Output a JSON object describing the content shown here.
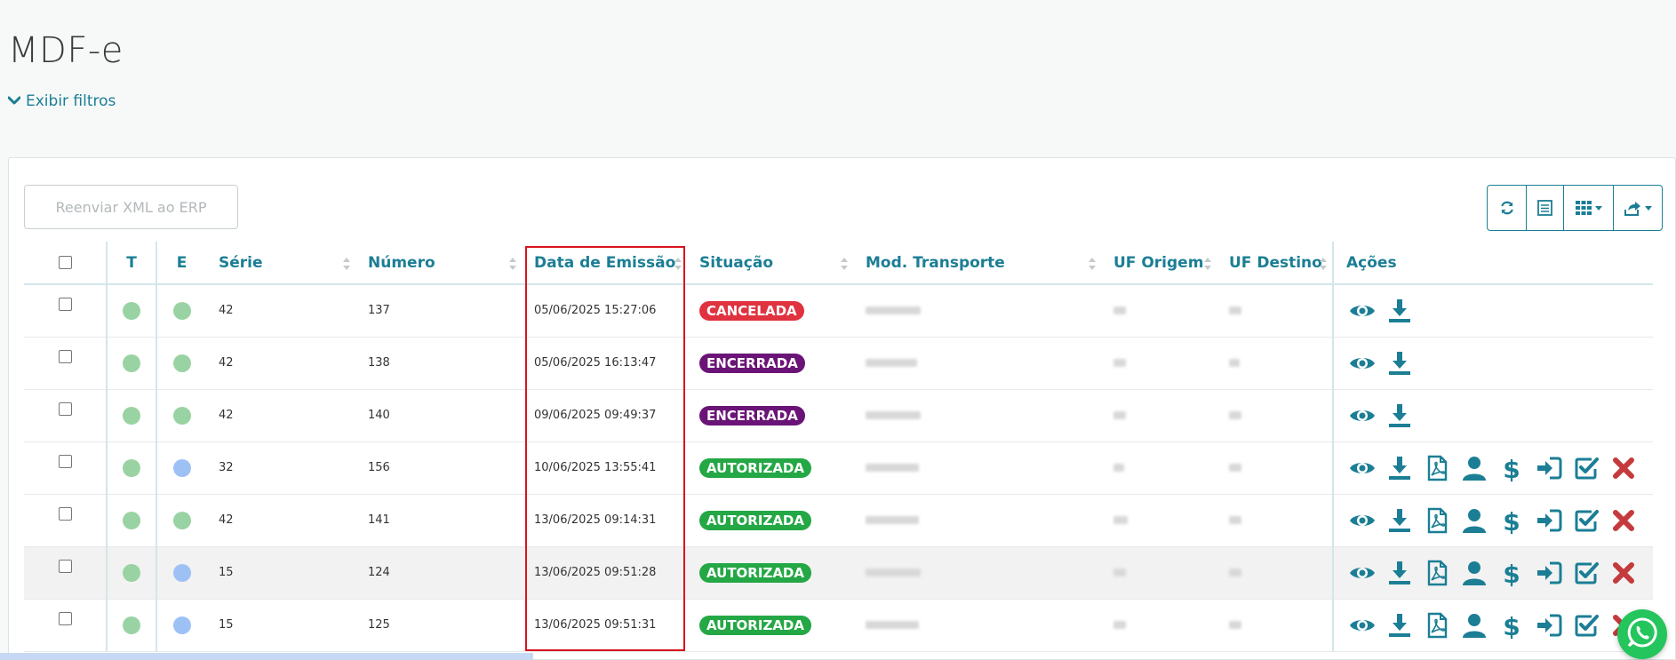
{
  "page": {
    "title": "MDF-e"
  },
  "filters": {
    "label": "Exibir filtros"
  },
  "toolbar": {
    "resend_label": "Reenviar XML ao ERP",
    "buttons": [
      "refresh-icon",
      "list-icon",
      "grid-columns-icon",
      "export-icon"
    ]
  },
  "colors": {
    "accent": "#1b7e95",
    "green_dot": "#9ad3a3",
    "blue_dot": "#9ec1f5",
    "cancelada": "#e0323f",
    "encerrada": "#6b1477",
    "autorizada": "#24a745",
    "cancel_x": "#c43a3d"
  },
  "table": {
    "columns": {
      "t": "T",
      "e": "E",
      "serie": "Série",
      "numero": "Número",
      "data": "Data de Emissão",
      "situacao": "Situação",
      "mod": "Mod. Transporte",
      "origem": "UF Origem",
      "destino": "UF Destino",
      "acoes": "Ações"
    },
    "rows": [
      {
        "t": "green",
        "e": "green",
        "serie": "42",
        "numero": "137",
        "data": "05/06/2025 15:27:06",
        "situacao": "CANCELADA",
        "status": "cancelada",
        "full_actions": false
      },
      {
        "t": "green",
        "e": "green",
        "serie": "42",
        "numero": "138",
        "data": "05/06/2025 16:13:47",
        "situacao": "ENCERRADA",
        "status": "encerrada",
        "full_actions": false
      },
      {
        "t": "green",
        "e": "green",
        "serie": "42",
        "numero": "140",
        "data": "09/06/2025 09:49:37",
        "situacao": "ENCERRADA",
        "status": "encerrada",
        "full_actions": false
      },
      {
        "t": "green",
        "e": "blue",
        "serie": "32",
        "numero": "156",
        "data": "10/06/2025 13:55:41",
        "situacao": "AUTORIZADA",
        "status": "autorizada",
        "full_actions": true
      },
      {
        "t": "green",
        "e": "green",
        "serie": "42",
        "numero": "141",
        "data": "13/06/2025 09:14:31",
        "situacao": "AUTORIZADA",
        "status": "autorizada",
        "full_actions": true
      },
      {
        "t": "green",
        "e": "blue",
        "serie": "15",
        "numero": "124",
        "data": "13/06/2025 09:51:28",
        "situacao": "AUTORIZADA",
        "status": "autorizada",
        "full_actions": true
      },
      {
        "t": "green",
        "e": "blue",
        "serie": "15",
        "numero": "125",
        "data": "13/06/2025 09:51:31",
        "situacao": "AUTORIZADA",
        "status": "autorizada",
        "full_actions": true
      }
    ],
    "action_icons_full": [
      "eye-icon",
      "download-icon",
      "pdf-icon",
      "user-icon",
      "dollar-icon",
      "sign-in-icon",
      "check-square-icon",
      "close-icon"
    ],
    "action_icons_basic": [
      "eye-icon",
      "download-icon"
    ]
  }
}
